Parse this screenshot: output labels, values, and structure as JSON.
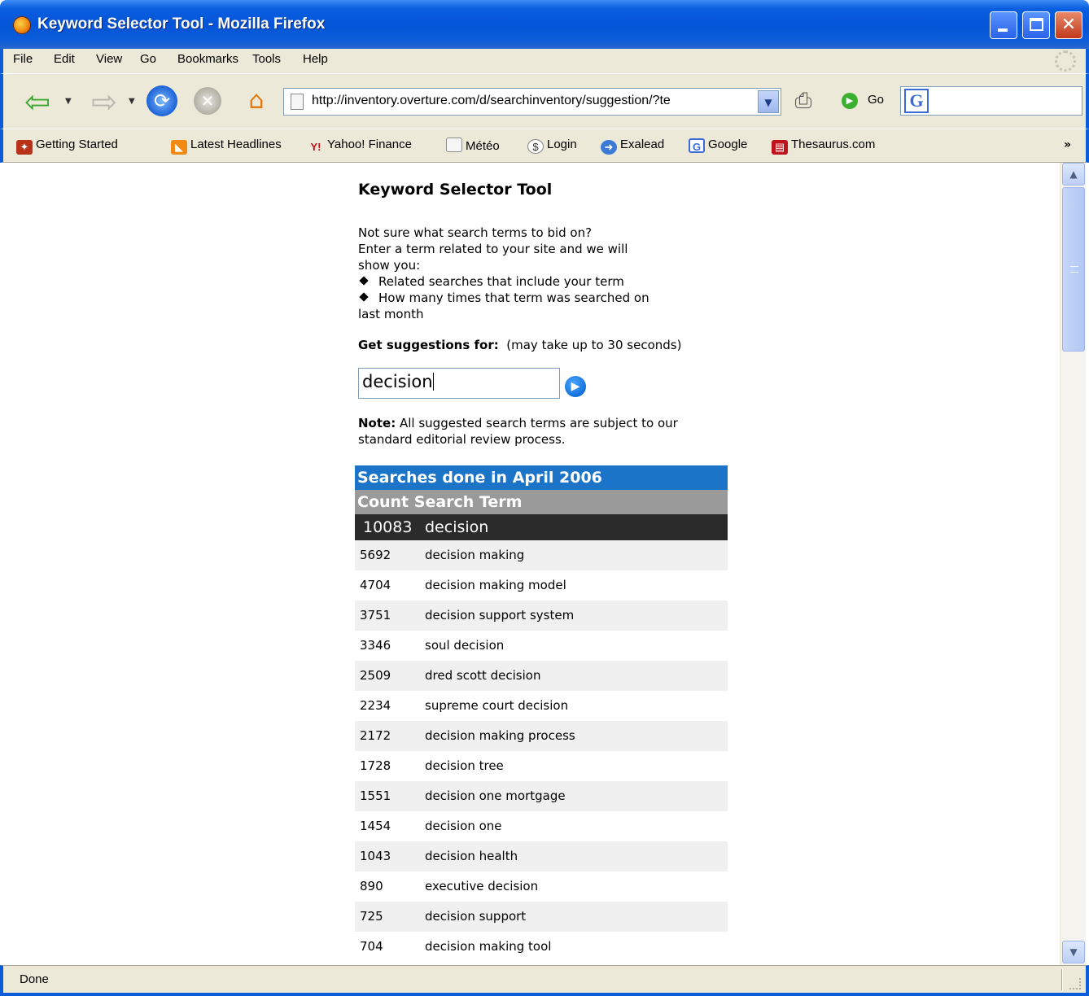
{
  "window": {
    "title": "Keyword Selector Tool - Mozilla Firefox"
  },
  "menu": [
    "File",
    "Edit",
    "View",
    "Go",
    "Bookmarks",
    "Tools",
    "Help"
  ],
  "nav": {
    "url": "http://inventory.overture.com/d/searchinventory/suggestion/?te",
    "go_label": "Go",
    "search_value": ""
  },
  "bookmarks": [
    {
      "label": "Getting Started",
      "icon": "firefox-icon"
    },
    {
      "label": "Latest Headlines",
      "icon": "rss-icon"
    },
    {
      "label": "Yahoo! Finance",
      "icon": "yahoo-icon"
    },
    {
      "label": "Météo",
      "icon": "page-icon"
    },
    {
      "label": "Login",
      "icon": "dollar-icon"
    },
    {
      "label": "Exalead",
      "icon": "arrow-icon"
    },
    {
      "label": "Google",
      "icon": "google-icon"
    },
    {
      "label": "Thesaurus.com",
      "icon": "book-icon"
    }
  ],
  "page": {
    "heading": "Keyword Selector Tool",
    "intro_lines": [
      "Not sure what search terms to bid on?",
      "Enter a term related to your site and we will",
      "show you:"
    ],
    "bullets": [
      "Related searches that include your term",
      "How many times that term was searched on"
    ],
    "bullet_tail": "last month",
    "get_label": "Get suggestions for:",
    "get_hint": "(may take up to 30 seconds)",
    "input_value": "decision",
    "note_label": "Note:",
    "note_text": "All suggested search terms are subject to our standard editorial review process."
  },
  "results": {
    "header": "Searches done in April 2006",
    "col_count": "Count",
    "col_term": "Search Term",
    "main": {
      "count": "10083",
      "term": "decision"
    },
    "rows": [
      {
        "count": "5692",
        "term": "decision making"
      },
      {
        "count": "4704",
        "term": "decision making model"
      },
      {
        "count": "3751",
        "term": "decision support system"
      },
      {
        "count": "3346",
        "term": "soul decision"
      },
      {
        "count": "2509",
        "term": "dred scott decision"
      },
      {
        "count": "2234",
        "term": "supreme court decision"
      },
      {
        "count": "2172",
        "term": "decision making process"
      },
      {
        "count": "1728",
        "term": "decision tree"
      },
      {
        "count": "1551",
        "term": "decision one mortgage"
      },
      {
        "count": "1454",
        "term": "decision one"
      },
      {
        "count": "1043",
        "term": "decision health"
      },
      {
        "count": "890",
        "term": "executive decision"
      },
      {
        "count": "725",
        "term": "decision support"
      },
      {
        "count": "704",
        "term": "decision making tool"
      }
    ]
  },
  "status": {
    "text": "Done"
  },
  "colors": {
    "title_blue": "#0554d8",
    "results_header": "#1c74c8",
    "results_cols": "#9a9a9a",
    "results_main": "#2b2b2b"
  }
}
